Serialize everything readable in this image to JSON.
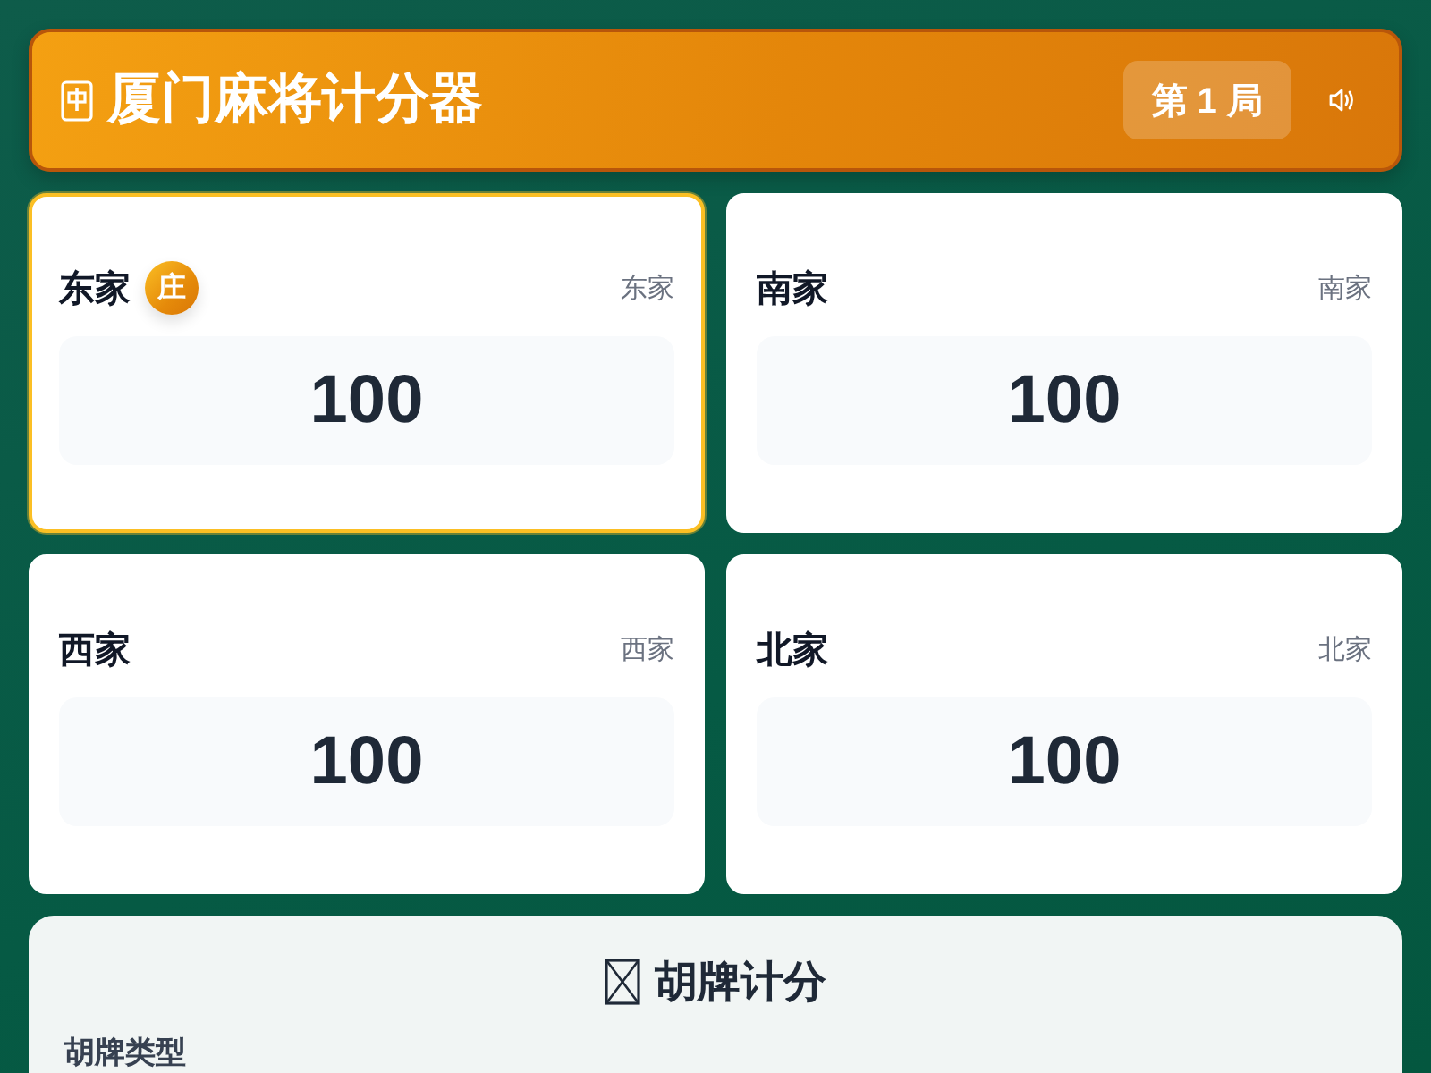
{
  "header": {
    "title": "厦门麻将计分器",
    "round": "第 1 局"
  },
  "dealer_badge": "庄",
  "players": [
    {
      "name": "东家",
      "seat": "东家",
      "score": "100",
      "dealer": true,
      "selected": true
    },
    {
      "name": "南家",
      "seat": "南家",
      "score": "100",
      "dealer": false,
      "selected": false
    },
    {
      "name": "西家",
      "seat": "西家",
      "score": "100",
      "dealer": false,
      "selected": false
    },
    {
      "name": "北家",
      "seat": "北家",
      "score": "100",
      "dealer": false,
      "selected": false
    }
  ],
  "win_panel": {
    "title": "胡牌计分",
    "field_label": "胡牌类型"
  }
}
